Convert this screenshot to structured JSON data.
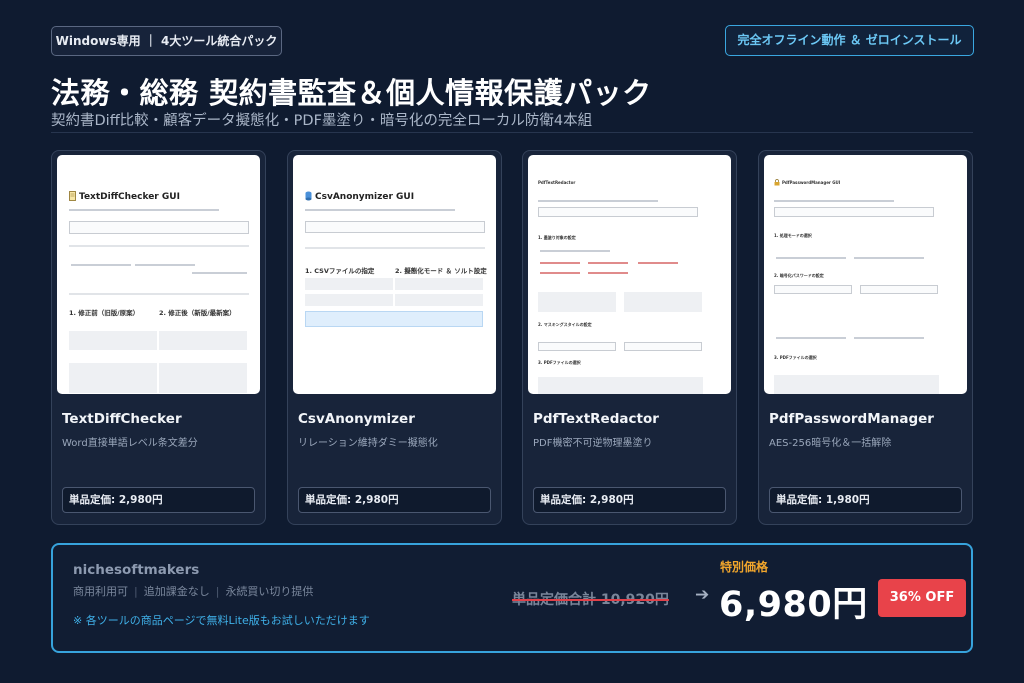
{
  "header": {
    "badge_left": "Windows専用 ｜ 4大ツール統合パック",
    "badge_right": "完全オフライン動作 ＆ ゼロインストール",
    "title": "法務・総務 契約書監査＆個人情報保護パック",
    "subtitle": "契約書Diff比較・顧客データ擬態化・PDF墨塗り・暗号化の完全ローカル防衛4本組"
  },
  "products": [
    {
      "name": "TextDiffChecker",
      "desc": "Word直接単語レベル条文差分",
      "price": "単品定価: 2,980円",
      "shot_title": "TextDiffChecker GUI",
      "shot_sections": [
        "1. 修正前（旧版/原案）",
        "2. 修正後（新版/最新案）"
      ],
      "icon": "notepad-icon"
    },
    {
      "name": "CsvAnonymizer",
      "desc": "リレーション維持ダミー擬態化",
      "price": "単品定価: 2,980円",
      "shot_title": "CsvAnonymizer GUI",
      "shot_sections": [
        "1. CSVファイルの指定",
        "2. 擬態化モード ＆ ソルト設定"
      ],
      "icon": "database-icon"
    },
    {
      "name": "PdfTextRedactor",
      "desc": "PDF機密不可逆物理墨塗り",
      "price": "単品定価: 2,980円",
      "shot_title": "PdfTextRedactor",
      "shot_sections": [
        "1. 墨塗り対象の設定",
        "2. マスキングスタイルの設定",
        "3. PDFファイルの選択"
      ],
      "icon": "pdf-icon"
    },
    {
      "name": "PdfPasswordManager",
      "desc": "AES-256暗号化＆一括解除",
      "price": "単品定価: 1,980円",
      "shot_title": "PdfPasswordManager GUI",
      "shot_sections": [
        "1. 処理モードの選択",
        "2. 暗号化パスワードの設定",
        "3. PDFファイルの選択"
      ],
      "icon": "lock-icon"
    }
  ],
  "bundle": {
    "brand": "nichesoftmakers",
    "terms": [
      "商用利用可",
      "追加課金なし",
      "永続買い切り提供"
    ],
    "note": "※ 各ツールの商品ページで無料Lite版もお試しいただけます",
    "old_price": "単品定価合計 10,920円",
    "arrow": "➔",
    "special_label": "特別価格",
    "special_price": "6,980円",
    "discount": "36% OFF"
  },
  "colors": {
    "background": "#0f1b30",
    "accent": "#37a3dc",
    "special": "#f2a62c",
    "discount_bg": "#e8434a"
  }
}
